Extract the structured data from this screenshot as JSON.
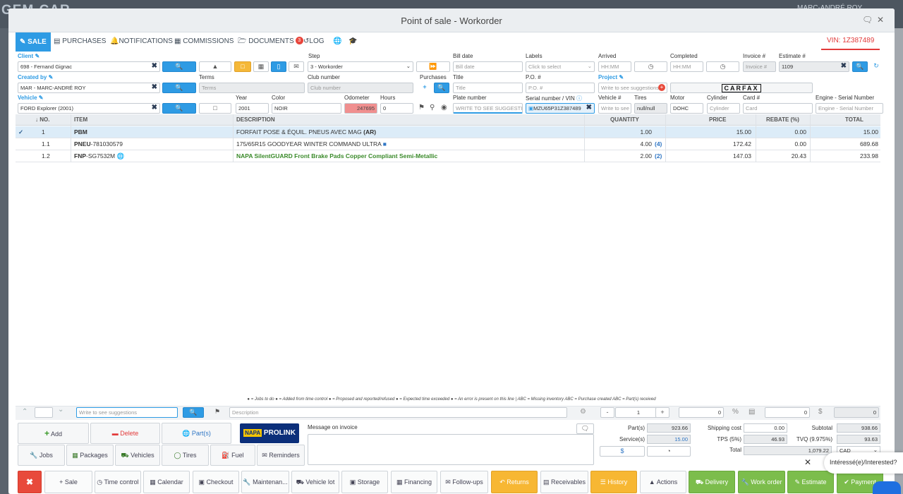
{
  "background": {
    "logo": "GEM-CAR",
    "user": "MARC-ANDRÉ ROY"
  },
  "window": {
    "title": "Point of sale - Workorder"
  },
  "tabs": [
    {
      "label": "SALE"
    },
    {
      "label": "PURCHASES"
    },
    {
      "label": "NOTIFICATIONS"
    },
    {
      "label": "COMMISSIONS"
    },
    {
      "label": "DOCUMENTS",
      "badge": "3"
    },
    {
      "label": "LOG"
    }
  ],
  "vin_tab": "VIN: 1Z387489",
  "form": {
    "client_label": "Client",
    "client_value": "698 - Fernand Gignac",
    "created_by_label": "Created by",
    "created_by_value": "MAR - MARC-ANDRÉ ROY",
    "vehicle_label": "Vehicle",
    "vehicle_value": "FORD Explorer (2001)",
    "terms_label": "Terms",
    "terms_ph": "Terms",
    "year_label": "Year",
    "year_value": "2001",
    "color_label": "Color",
    "color_value": "NOIR",
    "step_label": "Step",
    "step_value": "3 - Workorder",
    "club_label": "Club number",
    "club_ph": "Club number",
    "odometer_label": "Odometer",
    "odometer_value": "247695",
    "hours_label": "Hours",
    "hours_value": "0",
    "purchases_label": "Purchases",
    "bill_date_label": "Bill date",
    "bill_date_ph": "Bill date",
    "title_label": "Title",
    "title_ph": "Title",
    "plate_label": "Plate number",
    "plate_ph": "WRITE TO SEE SUGGESTION",
    "labels_label": "Labels",
    "labels_ph": "Click to select",
    "po_label": "P.O. #",
    "po_ph": "P.O. #",
    "serial_label": "Serial number / VIN",
    "serial_value": "MZU65P31Z387489",
    "arrived_label": "Arrived",
    "arrived_ph": "HH:MM",
    "project_label": "Project",
    "project_ph": "Write to see suggestions",
    "vehicle_no_label": "Vehicle #",
    "vehicle_no_ph": "Write to see",
    "tires_label": "Tires",
    "tires_value": "null/null",
    "completed_label": "Completed",
    "completed_ph": "HH:MM",
    "motor_label": "Motor",
    "motor_value": "DOHC",
    "cylinder_label": "Cylinder",
    "cylinder_ph": "Cylinder",
    "carfax": "CARFAX",
    "invoice_label": "Invoice #",
    "invoice_ph": "Invoice #",
    "estimate_label": "Estimate #",
    "estimate_value": "1109",
    "card_label": "Card #",
    "card_ph": "Card",
    "engine_label": "Engine - Serial Number",
    "engine_ph": "Engine - Serial Number"
  },
  "table": {
    "headers": {
      "no": "NO.",
      "item": "ITEM",
      "description": "DESCRIPTION",
      "quantity": "QUANTITY",
      "price": "PRICE",
      "rebate": "REBATE (%)",
      "total": "TOTAL"
    },
    "rows": [
      {
        "no": "1",
        "item_bold": "PBM",
        "item_rest": "",
        "description": "FORFAIT POSE & ÉQUIL. PNEUS AVEC MAG",
        "desc_suffix": "(AR)",
        "quantity": "1.00",
        "qty_note": "",
        "price": "15.00",
        "rebate": "0.00",
        "total": "15.00"
      },
      {
        "no": "1.1",
        "item_bold": "PNEU",
        "item_rest": "-781030579",
        "description": "175/65R15 GOODYEAR WINTER COMMAND ULTRA",
        "desc_suffix": "",
        "quantity": "4.00",
        "qty_note": "(4)",
        "price": "172.42",
        "rebate": "0.00",
        "total": "689.68"
      },
      {
        "no": "1.2",
        "item_bold": "FNP",
        "item_rest": "-SG7532M",
        "description": "NAPA SilentGUARD Front Brake Pads Copper Compliant Semi-Metallic",
        "desc_suffix": "",
        "quantity": "2.00",
        "qty_note": "(2)",
        "price": "147.03",
        "rebate": "20.43",
        "total": "233.98"
      }
    ]
  },
  "legend": "● = Jobs to do  ● = Added from time control  ● = Proposed and reported/refused  ● = Expected time exceeded  ● = An error is present on this line   |   ABC = Missing inventory ABC = Purchase created ABC = Part(s) received",
  "editor": {
    "suggest_ph": "Write to see suggestions",
    "desc_ph": "Description",
    "qty": "1",
    "discount": "0",
    "amount": "0",
    "price": "0"
  },
  "actions": {
    "add": "Add",
    "delete": "Delete",
    "parts": "Part(s)",
    "prolink": "PROLINK",
    "jobs": "Jobs",
    "packages": "Packages",
    "vehicles": "Vehicles",
    "tires": "Tires",
    "fuel": "Fuel",
    "reminders": "Reminders"
  },
  "message": {
    "label": "Message on invoice"
  },
  "totals": {
    "parts_label": "Part(s)",
    "parts": "923.66",
    "services_label": "Service(s)",
    "services": "15.00",
    "shipping_label": "Shipping cost",
    "shipping": "0.00",
    "tps_label": "TPS (5%)",
    "tps": "46.93",
    "total_label": "Total",
    "total": "1,079.22",
    "subtotal_label": "Subtotal",
    "subtotal": "938.66",
    "tvq_label": "TVQ (9.975%)",
    "tvq": "93.63",
    "currency": "CAD"
  },
  "taskbar": [
    {
      "label": "Sale"
    },
    {
      "label": "Time control"
    },
    {
      "label": "Calendar"
    },
    {
      "label": "Checkout"
    },
    {
      "label": "Maintenan..."
    },
    {
      "label": "Vehicle lot"
    },
    {
      "label": "Storage"
    },
    {
      "label": "Financing"
    },
    {
      "label": "Follow-ups"
    },
    {
      "label": "Returns"
    },
    {
      "label": "Receivables"
    },
    {
      "label": "History"
    },
    {
      "label": "Actions"
    },
    {
      "label": "Delivery"
    },
    {
      "label": "Work order"
    },
    {
      "label": "Estimate"
    },
    {
      "label": "Payment"
    }
  ],
  "chat": {
    "text": "Intéressé(e)/Interested?"
  },
  "colors": {
    "accent": "#2e9be4",
    "vin": "#e23a3a",
    "green": "#7cbd4c",
    "orange": "#f7b733",
    "close": "#e84a3b"
  }
}
